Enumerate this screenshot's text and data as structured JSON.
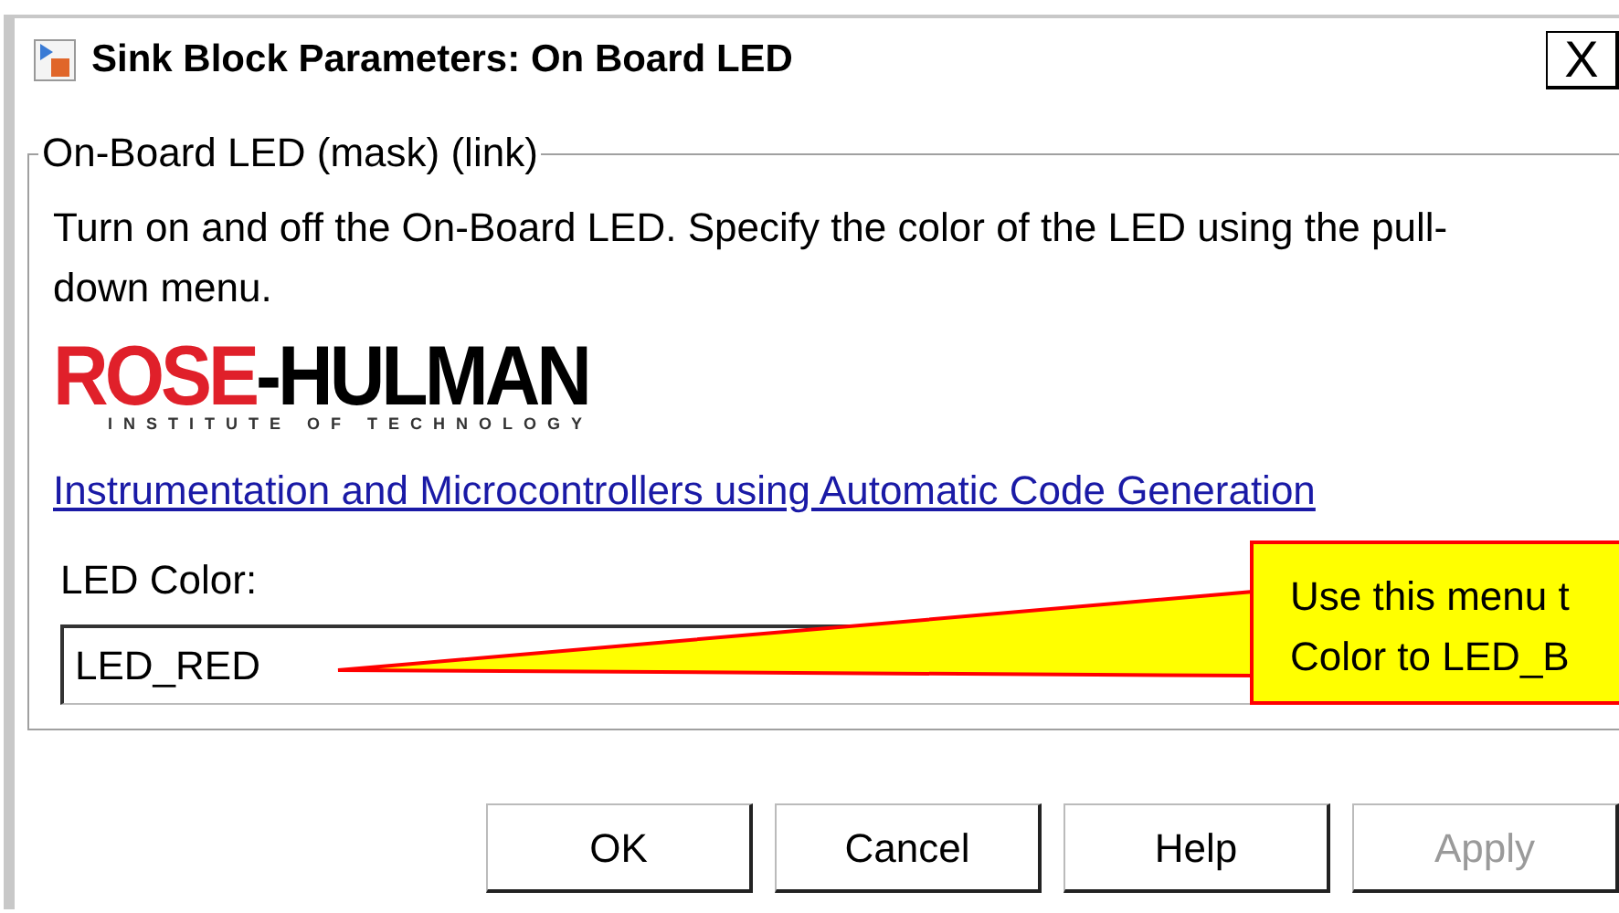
{
  "window": {
    "title": "Sink Block Parameters: On Board LED",
    "close": "X"
  },
  "group": {
    "legend": "On-Board LED (mask) (link)",
    "description": "Turn on and off the On-Board LED. Specify the color of the LED using the pull-down menu.",
    "logo": {
      "wordmark_first": "ROSE",
      "wordmark_second": "-HULMAN",
      "tagline": "INSTITUTE OF TECHNOLOGY"
    },
    "link": "Instrumentation and Microcontrollers using Automatic Code Generation",
    "field": {
      "label": "LED Color:",
      "value": "LED_RED"
    }
  },
  "callout": {
    "lines": [
      "Use this menu t",
      "Color to LED_B"
    ]
  },
  "buttons": [
    {
      "label": "OK",
      "disabled": false
    },
    {
      "label": "Cancel",
      "disabled": false
    },
    {
      "label": "Help",
      "disabled": false
    },
    {
      "label": "Apply",
      "disabled": true
    }
  ]
}
